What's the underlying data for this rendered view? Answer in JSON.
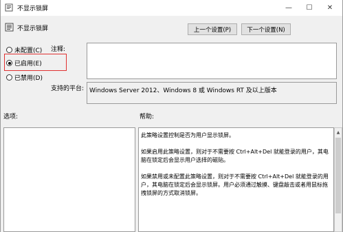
{
  "window": {
    "title": "不显示锁屏",
    "minimize_glyph": "—",
    "maximize_glyph": "☐",
    "close_glyph": "✕"
  },
  "header": {
    "setting_name": "不显示锁屏"
  },
  "nav": {
    "prev_label": "上一个设置(P)",
    "next_label": "下一个设置(N)"
  },
  "state": {
    "options": [
      {
        "label": "未配置(C)",
        "selected": false
      },
      {
        "label": "已启用(E)",
        "selected": true
      },
      {
        "label": "已禁用(D)",
        "selected": false
      }
    ]
  },
  "comment": {
    "label": "注释:",
    "value": ""
  },
  "platform": {
    "label": "支持的平台:",
    "value": "Windows Server 2012、Windows 8 或 Windows RT 及以上版本"
  },
  "panes": {
    "options_label": "选项:",
    "help_label": "帮助:"
  },
  "help": {
    "paragraphs": [
      "此策略设置控制是否为用户显示锁屏。",
      "如果启用此策略设置，则对于不需要按 Ctrl+Alt+Del 就能登录的用户，其电脑在锁定后会显示用户选择的磁贴。",
      "如果禁用或未配置此策略设置，则对于不需要按 Ctrl+Alt+Del 就能登录的用户，其电脑在锁定后会显示锁屏。用户必须通过触摸、键盘敲击或者用鼠标拖拽锁屏的方式取消锁屏。"
    ]
  },
  "colors": {
    "highlight_border": "#e03030"
  }
}
